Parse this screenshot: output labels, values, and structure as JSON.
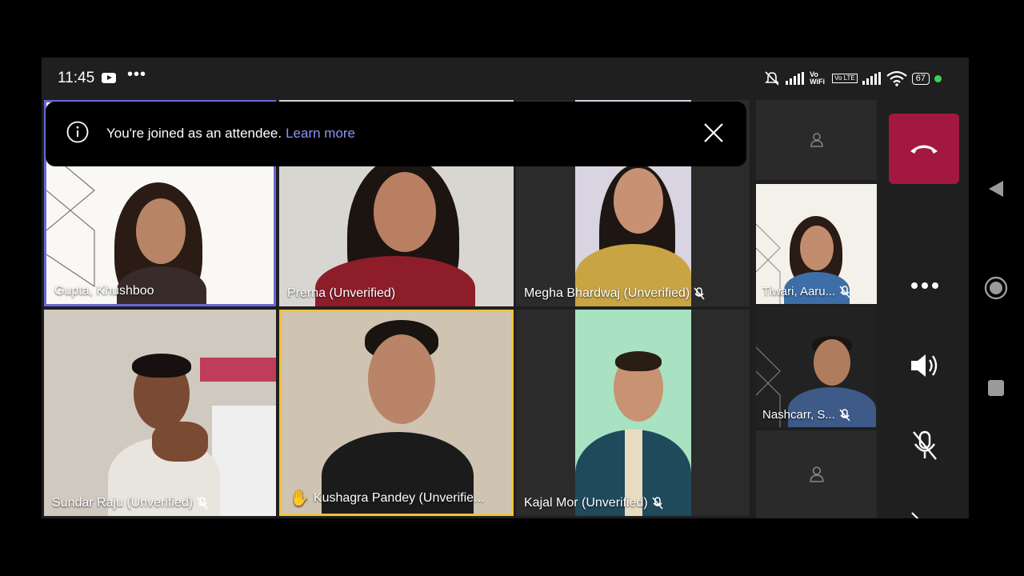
{
  "status": {
    "time": "11:45",
    "more": "•••",
    "net1": "Vo WiFi",
    "net2": "Vo LTE",
    "battery": "67"
  },
  "toast": {
    "message": "You're joined as an attendee.",
    "link": "Learn more"
  },
  "participants": [
    {
      "name": "Gupta, Khushboo"
    },
    {
      "name": "Prerna (Unverified)"
    },
    {
      "name": "Megha Bhardwaj  (Unverified)"
    },
    {
      "name": "Sundar Raju (Unverified)"
    },
    {
      "name": "Kushagra Pandey (Unverifie..."
    },
    {
      "name": "Kajal Mor (Unverified)"
    }
  ],
  "rail": [
    {
      "name": "Tiwari, Aaru..."
    },
    {
      "name": "Nashcarr, S..."
    }
  ],
  "colors": {
    "end_call": "#a2183f",
    "active_speaker": "#6b66d8",
    "raised_hand": "#f3c13a",
    "link": "#8e95f5"
  },
  "icons": [
    "info-icon",
    "close-icon",
    "hang-up-icon",
    "more-icon",
    "speaker-icon",
    "mic-off-icon",
    "camera-off-icon",
    "hand-raised-icon",
    "person-icon"
  ]
}
